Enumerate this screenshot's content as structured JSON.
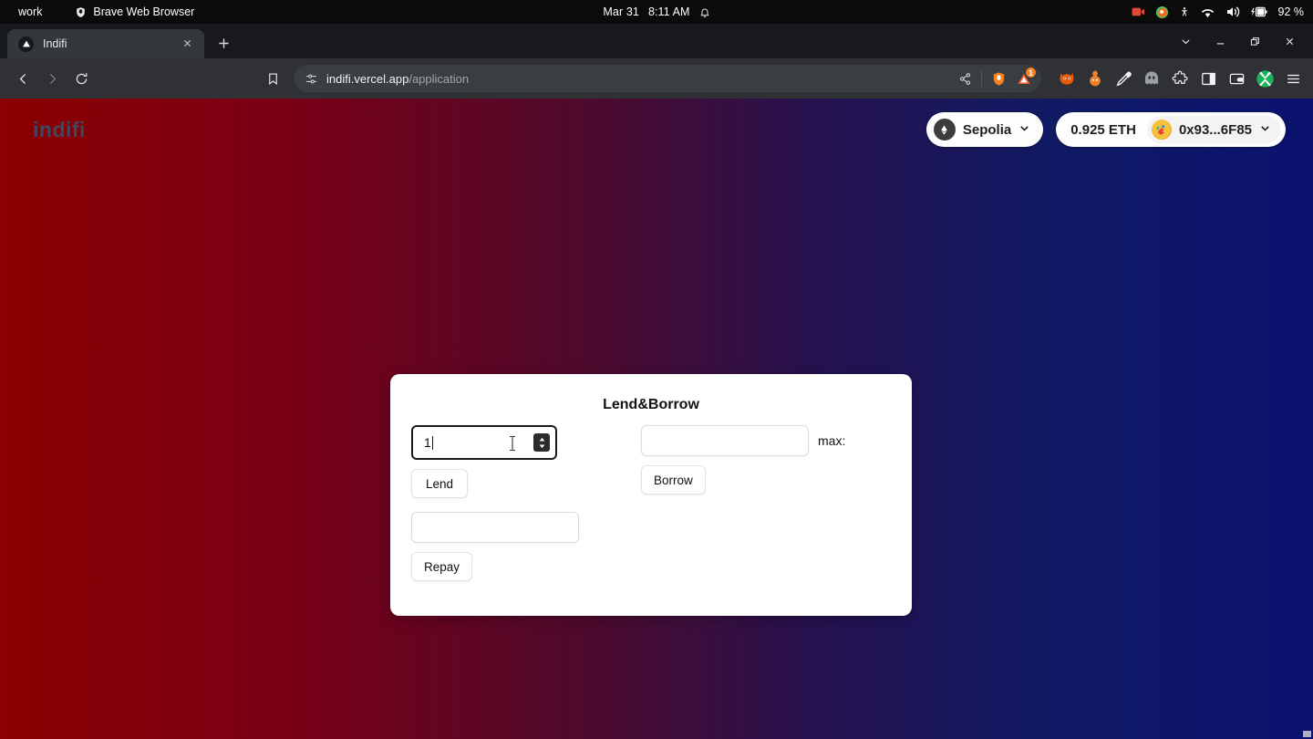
{
  "os_bar": {
    "workspace": "work",
    "app_name": "Brave Web Browser",
    "app_icon": "brave-lion-icon",
    "date": "Mar 31",
    "time": "8:11 AM",
    "bell_icon": "notification-bell-icon",
    "tray_icons": [
      "screen-record-icon",
      "firefox-icon",
      "accessibility-icon",
      "wifi-icon",
      "volume-icon",
      "battery-charging-icon"
    ],
    "battery": "92 %"
  },
  "browser": {
    "tab": {
      "title": "Indifi",
      "favicon": "vercel-triangle-icon",
      "close_icon": "close-icon"
    },
    "new_tab_icon": "plus-icon",
    "window_controls": [
      "tab-search-chevron-icon",
      "minimize-icon",
      "restore-icon",
      "close-window-icon"
    ],
    "nav": {
      "back_icon": "back-arrow-icon",
      "forward_icon": "forward-arrow-icon",
      "reload_icon": "reload-icon",
      "bookmark_icon": "bookmark-icon"
    },
    "omnibox": {
      "site_settings_icon": "site-settings-icon",
      "domain": "indifi.vercel.app",
      "path": "/application",
      "share_icon": "share-icon",
      "shields_icon": "brave-shields-icon",
      "vercel_icon": "vercel-triangle-icon",
      "vercel_badge": "1"
    },
    "extensions": [
      "firefox-fox-icon",
      "rabby-wallet-icon",
      "eyedropper-icon",
      "phantom-ghost-icon",
      "puzzle-extensions-icon",
      "sidebar-panel-icon",
      "wallet-icon",
      "metamask-icon"
    ],
    "menu_icon": "hamburger-menu-icon"
  },
  "site": {
    "brand": "indifi",
    "network": {
      "chain_icon": "ethereum-icon",
      "name": "Sepolia",
      "chevron_icon": "chevron-down-icon"
    },
    "account": {
      "balance": "0.925 ETH",
      "avatar_icon": "jazzicon-avatar",
      "address": "0x93...6F85",
      "chevron_icon": "chevron-down-icon"
    }
  },
  "card": {
    "title": "Lend&Borrow",
    "lend": {
      "amount_value": "1",
      "amount_placeholder": "",
      "spinner_icon": "number-spinner-icon",
      "button_label": "Lend"
    },
    "repay": {
      "amount_value": "",
      "amount_placeholder": "",
      "button_label": "Repay"
    },
    "borrow": {
      "amount_value": "",
      "amount_placeholder": "",
      "button_label": "Borrow",
      "max_label": "max:",
      "max_value": ""
    }
  },
  "colors": {
    "gradient_start": "#8b0000",
    "gradient_end": "#0b1270",
    "brand_text": "#3b4a63",
    "accent_orange": "#f6821f",
    "card_bg": "#ffffff"
  }
}
